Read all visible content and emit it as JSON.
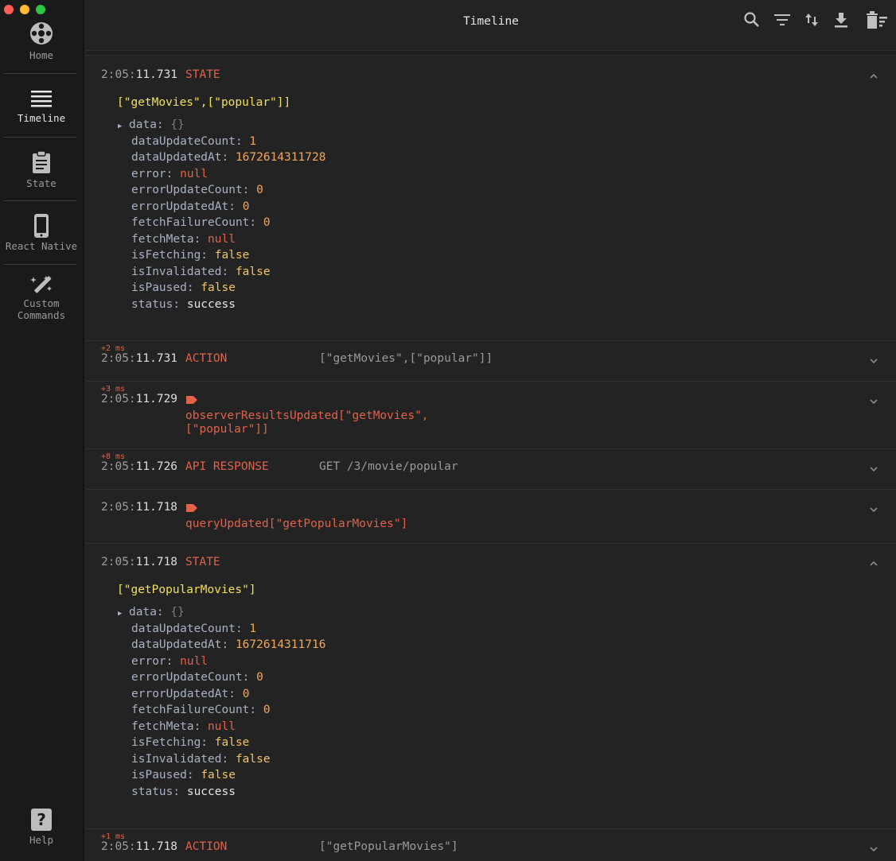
{
  "window": {
    "title": "Timeline"
  },
  "sidebar": {
    "items": [
      {
        "label": "Home",
        "icon": "home-reel-icon"
      },
      {
        "label": "Timeline",
        "icon": "timeline-list-icon"
      },
      {
        "label": "State",
        "icon": "clipboard-icon"
      },
      {
        "label": "React Native",
        "icon": "phone-icon"
      },
      {
        "label_line1": "Custom",
        "label_line2": "Commands",
        "icon": "magic-wand-icon"
      },
      {
        "label": "Help",
        "icon": "help-icon"
      }
    ]
  },
  "toolbar": {
    "icons": [
      "search-icon",
      "filter-icon",
      "sort-icon",
      "download-icon",
      "clear-icon"
    ]
  },
  "entries": [
    {
      "time_prefix": "2:05:",
      "time_ms": "11.731",
      "type": "STATE",
      "key": "[\"getMovies\",[\"popular\"]]",
      "data_label": "data:",
      "data_value": "{}",
      "fields": [
        {
          "k": "dataUpdateCount:",
          "v": "1"
        },
        {
          "k": "dataUpdatedAt:",
          "v": "1672614311728"
        },
        {
          "k": "error:",
          "v": "null"
        },
        {
          "k": "errorUpdateCount:",
          "v": "0"
        },
        {
          "k": "errorUpdatedAt:",
          "v": "0"
        },
        {
          "k": "fetchFailureCount:",
          "v": "0"
        },
        {
          "k": "fetchMeta:",
          "v": "null"
        },
        {
          "k": "isFetching:",
          "v": "false"
        },
        {
          "k": "isInvalidated:",
          "v": "false"
        },
        {
          "k": "isPaused:",
          "v": "false"
        },
        {
          "k": "status:",
          "v": "success"
        }
      ]
    },
    {
      "delta": "+2 ms",
      "time_prefix": "2:05:",
      "time_ms": "11.731",
      "type": "ACTION",
      "sub": "[\"getMovies\",[\"popular\"]]"
    },
    {
      "delta": "+3 ms",
      "time_prefix": "2:05:",
      "time_ms": "11.729",
      "line1": "observerResultsUpdated[\"getMovies\",",
      "line2": "[\"popular\"]]"
    },
    {
      "delta": "+8 ms",
      "time_prefix": "2:05:",
      "time_ms": "11.726",
      "type": "API RESPONSE",
      "sub": "GET /3/movie/popular"
    },
    {
      "time_prefix": "2:05:",
      "time_ms": "11.718",
      "line1": "queryUpdated[\"getPopularMovies\"]"
    },
    {
      "time_prefix": "2:05:",
      "time_ms": "11.718",
      "type": "STATE",
      "key": "[\"getPopularMovies\"]",
      "data_label": "data:",
      "data_value": "{}",
      "fields": [
        {
          "k": "dataUpdateCount:",
          "v": "1"
        },
        {
          "k": "dataUpdatedAt:",
          "v": "1672614311716"
        },
        {
          "k": "error:",
          "v": "null"
        },
        {
          "k": "errorUpdateCount:",
          "v": "0"
        },
        {
          "k": "errorUpdatedAt:",
          "v": "0"
        },
        {
          "k": "fetchFailureCount:",
          "v": "0"
        },
        {
          "k": "fetchMeta:",
          "v": "null"
        },
        {
          "k": "isFetching:",
          "v": "false"
        },
        {
          "k": "isInvalidated:",
          "v": "false"
        },
        {
          "k": "isPaused:",
          "v": "false"
        },
        {
          "k": "status:",
          "v": "success"
        }
      ]
    },
    {
      "delta": "+1 ms",
      "time_prefix": "2:05:",
      "time_ms": "11.718",
      "type": "ACTION",
      "sub": "[\"getPopularMovies\"]"
    }
  ]
}
